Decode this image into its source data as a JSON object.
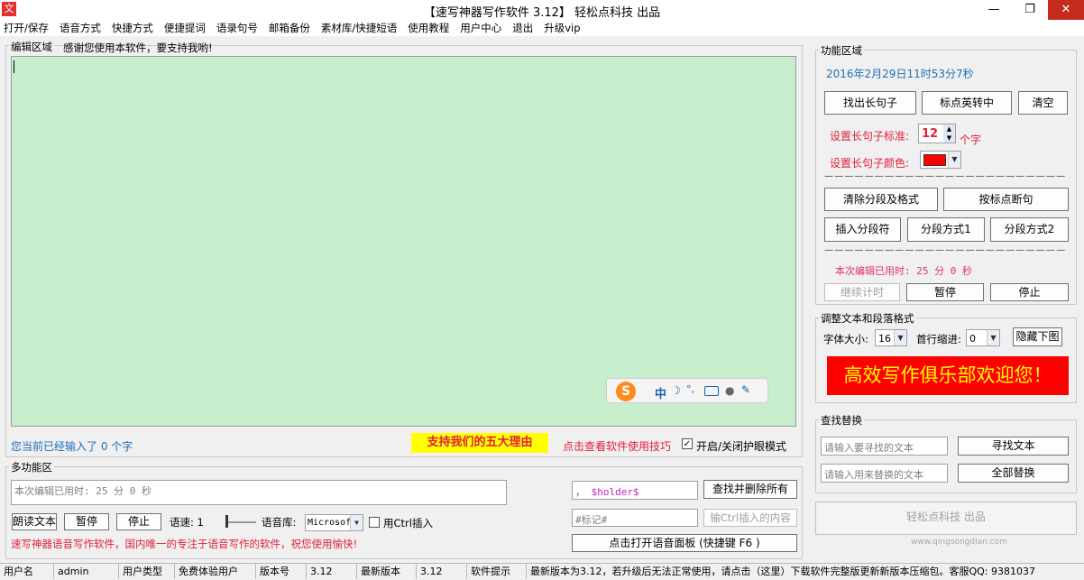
{
  "window": {
    "title": "【速写神器写作软件 3.12】   轻松点科技  出品",
    "app_icon": "文",
    "minimize": "—",
    "maximize": "❐",
    "close": "✕"
  },
  "menu": [
    "打开/保存",
    "语音方式",
    "快捷方式",
    "便捷提词",
    "语录句号",
    "邮箱备份",
    "素材库/快捷短语",
    "使用教程",
    "用户中心",
    "退出",
    "升级vip"
  ],
  "editor": {
    "label": "编辑区域",
    "thanks": "感谢您使用本软件，要支持我哟!",
    "ime_label": "中",
    "ime_symbols": "°,",
    "count_text": "您当前已经输入了 0 个字",
    "five_reasons": "支持我们的五大理由",
    "tips_link": "点击查看软件使用技巧",
    "eye_mode": "开启/关闭护眼模式",
    "eye_checked": true
  },
  "multi": {
    "label": "多功能区",
    "elapsed": "本次编辑已用时: 25 分 0 秒",
    "read_btn": "朗读文本",
    "pause_btn": "暂停",
    "stop_btn": "停止",
    "speed_label": "语速: 1",
    "voice_label": "语音库:",
    "voice_value": "Microsof",
    "ctrl_insert": "用Ctrl插入",
    "slogan": "速写神器语音写作软件，国内唯一的专注于语音写作的软件，祝您使用愉快!",
    "holder_value": "，  $holder$",
    "find_delete_btn": "查找并删除所有",
    "mark_placeholder": "#标记#",
    "ctrl_insert_btn": "输Ctrl插入的内容",
    "voice_panel_btn": "点击打开语音面板  (快捷键 F6 )"
  },
  "func": {
    "label": "功能区域",
    "datetime": "2016年2月29日11时53分7秒",
    "find_long_btn": "找出长句子",
    "punct_btn": "标点英转中",
    "clear_btn": "清空",
    "long_std_label": "设置长句子标准:",
    "long_std_value": "12",
    "unit": "个字",
    "long_color_label": "设置长句子颜色:",
    "long_color": "#ff0000",
    "dashes": "— — — — — — — — — — — — — — — — — — — — — — — —",
    "clear_para_btn": "清除分段及格式",
    "punct_break_btn": "按标点断句",
    "insert_para_btn": "插入分段符",
    "para_mode1_btn": "分段方式1",
    "para_mode2_btn": "分段方式2",
    "elapsed": "本次编辑已用时: 25 分 0 秒",
    "continue_btn": "继续计时",
    "pause_btn": "暂停",
    "stop_btn": "停止"
  },
  "format": {
    "label": "调整文本和段落格式",
    "font_size_label": "字体大小:",
    "font_size": "16",
    "indent_label": "首行缩进:",
    "indent": "0",
    "hide_img_btn": "隐藏下图",
    "banner": "高效写作俱乐部欢迎您！",
    "banner_bg": "#ff0000",
    "banner_fg": "#ffff00"
  },
  "search": {
    "label": "查找替换",
    "find_placeholder": "请输入要寻找的文本",
    "find_btn": "寻找文本",
    "replace_placeholder": "请输入用来替换的文本",
    "replace_btn": "全部替换"
  },
  "company_btn": "轻松点科技  出品",
  "watermark": "www.qingsongdian.com",
  "status": {
    "user_label": "用户名",
    "user": "admin",
    "type_label": "用户类型",
    "type": "免费体验用户",
    "ver_label": "版本号",
    "ver": "3.12",
    "latest_label": "最新版本",
    "latest": "3.12",
    "tip_label": "软件提示",
    "tip": "最新版本为3.12，若升级后无法正常使用，请点击（这里）下载软件完整版更新新版本压缩包。客服QQ: 9381037"
  }
}
